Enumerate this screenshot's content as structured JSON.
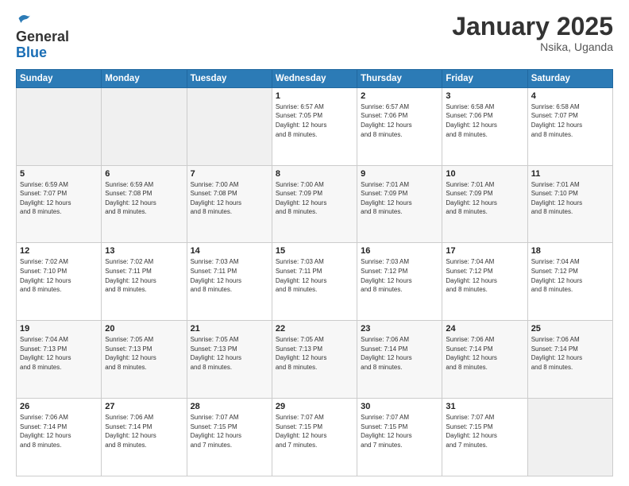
{
  "logo": {
    "line1": "General",
    "line2": "Blue"
  },
  "header": {
    "title": "January 2025",
    "subtitle": "Nsika, Uganda"
  },
  "weekdays": [
    "Sunday",
    "Monday",
    "Tuesday",
    "Wednesday",
    "Thursday",
    "Friday",
    "Saturday"
  ],
  "weeks": [
    [
      {
        "day": "",
        "info": ""
      },
      {
        "day": "",
        "info": ""
      },
      {
        "day": "",
        "info": ""
      },
      {
        "day": "1",
        "info": "Sunrise: 6:57 AM\nSunset: 7:05 PM\nDaylight: 12 hours\nand 8 minutes."
      },
      {
        "day": "2",
        "info": "Sunrise: 6:57 AM\nSunset: 7:06 PM\nDaylight: 12 hours\nand 8 minutes."
      },
      {
        "day": "3",
        "info": "Sunrise: 6:58 AM\nSunset: 7:06 PM\nDaylight: 12 hours\nand 8 minutes."
      },
      {
        "day": "4",
        "info": "Sunrise: 6:58 AM\nSunset: 7:07 PM\nDaylight: 12 hours\nand 8 minutes."
      }
    ],
    [
      {
        "day": "5",
        "info": "Sunrise: 6:59 AM\nSunset: 7:07 PM\nDaylight: 12 hours\nand 8 minutes."
      },
      {
        "day": "6",
        "info": "Sunrise: 6:59 AM\nSunset: 7:08 PM\nDaylight: 12 hours\nand 8 minutes."
      },
      {
        "day": "7",
        "info": "Sunrise: 7:00 AM\nSunset: 7:08 PM\nDaylight: 12 hours\nand 8 minutes."
      },
      {
        "day": "8",
        "info": "Sunrise: 7:00 AM\nSunset: 7:09 PM\nDaylight: 12 hours\nand 8 minutes."
      },
      {
        "day": "9",
        "info": "Sunrise: 7:01 AM\nSunset: 7:09 PM\nDaylight: 12 hours\nand 8 minutes."
      },
      {
        "day": "10",
        "info": "Sunrise: 7:01 AM\nSunset: 7:09 PM\nDaylight: 12 hours\nand 8 minutes."
      },
      {
        "day": "11",
        "info": "Sunrise: 7:01 AM\nSunset: 7:10 PM\nDaylight: 12 hours\nand 8 minutes."
      }
    ],
    [
      {
        "day": "12",
        "info": "Sunrise: 7:02 AM\nSunset: 7:10 PM\nDaylight: 12 hours\nand 8 minutes."
      },
      {
        "day": "13",
        "info": "Sunrise: 7:02 AM\nSunset: 7:11 PM\nDaylight: 12 hours\nand 8 minutes."
      },
      {
        "day": "14",
        "info": "Sunrise: 7:03 AM\nSunset: 7:11 PM\nDaylight: 12 hours\nand 8 minutes."
      },
      {
        "day": "15",
        "info": "Sunrise: 7:03 AM\nSunset: 7:11 PM\nDaylight: 12 hours\nand 8 minutes."
      },
      {
        "day": "16",
        "info": "Sunrise: 7:03 AM\nSunset: 7:12 PM\nDaylight: 12 hours\nand 8 minutes."
      },
      {
        "day": "17",
        "info": "Sunrise: 7:04 AM\nSunset: 7:12 PM\nDaylight: 12 hours\nand 8 minutes."
      },
      {
        "day": "18",
        "info": "Sunrise: 7:04 AM\nSunset: 7:12 PM\nDaylight: 12 hours\nand 8 minutes."
      }
    ],
    [
      {
        "day": "19",
        "info": "Sunrise: 7:04 AM\nSunset: 7:13 PM\nDaylight: 12 hours\nand 8 minutes."
      },
      {
        "day": "20",
        "info": "Sunrise: 7:05 AM\nSunset: 7:13 PM\nDaylight: 12 hours\nand 8 minutes."
      },
      {
        "day": "21",
        "info": "Sunrise: 7:05 AM\nSunset: 7:13 PM\nDaylight: 12 hours\nand 8 minutes."
      },
      {
        "day": "22",
        "info": "Sunrise: 7:05 AM\nSunset: 7:13 PM\nDaylight: 12 hours\nand 8 minutes."
      },
      {
        "day": "23",
        "info": "Sunrise: 7:06 AM\nSunset: 7:14 PM\nDaylight: 12 hours\nand 8 minutes."
      },
      {
        "day": "24",
        "info": "Sunrise: 7:06 AM\nSunset: 7:14 PM\nDaylight: 12 hours\nand 8 minutes."
      },
      {
        "day": "25",
        "info": "Sunrise: 7:06 AM\nSunset: 7:14 PM\nDaylight: 12 hours\nand 8 minutes."
      }
    ],
    [
      {
        "day": "26",
        "info": "Sunrise: 7:06 AM\nSunset: 7:14 PM\nDaylight: 12 hours\nand 8 minutes."
      },
      {
        "day": "27",
        "info": "Sunrise: 7:06 AM\nSunset: 7:14 PM\nDaylight: 12 hours\nand 8 minutes."
      },
      {
        "day": "28",
        "info": "Sunrise: 7:07 AM\nSunset: 7:15 PM\nDaylight: 12 hours\nand 7 minutes."
      },
      {
        "day": "29",
        "info": "Sunrise: 7:07 AM\nSunset: 7:15 PM\nDaylight: 12 hours\nand 7 minutes."
      },
      {
        "day": "30",
        "info": "Sunrise: 7:07 AM\nSunset: 7:15 PM\nDaylight: 12 hours\nand 7 minutes."
      },
      {
        "day": "31",
        "info": "Sunrise: 7:07 AM\nSunset: 7:15 PM\nDaylight: 12 hours\nand 7 minutes."
      },
      {
        "day": "",
        "info": ""
      }
    ]
  ]
}
